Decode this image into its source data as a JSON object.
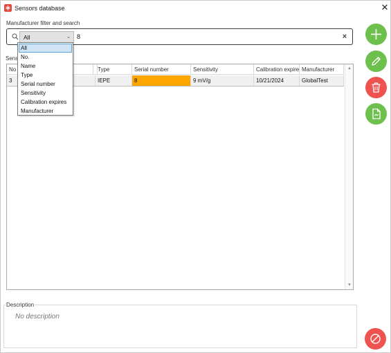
{
  "window": {
    "title": "Sensors database",
    "close_glyph": "✕"
  },
  "filter": {
    "group_label": "Manufacturer filter and search",
    "combo_value": "All",
    "search_value": "8",
    "clear_glyph": "×"
  },
  "sensors": {
    "group_label": "Sensors",
    "visible_label": "Senso",
    "columns": [
      "No.",
      "Name",
      "Type",
      "Serial number",
      "Sensitivity",
      "Calibration expires",
      "Manufacturer"
    ],
    "visible_columns": [
      "No",
      "",
      "Type",
      "Serial number",
      "Sensitivity",
      "Calibration expire",
      "Manufacturer"
    ],
    "rows": [
      {
        "no": "3",
        "name": "",
        "type": "IEPE",
        "serial_number": "8",
        "sensitivity": "9 mV/g",
        "calibration_expires": "10/21/2024",
        "manufacturer": "GlobalTest"
      }
    ],
    "highlight_color": "#ffa500"
  },
  "dropdown": {
    "options": [
      "All",
      "No.",
      "Name",
      "Type",
      "Serial number",
      "Sensitivity",
      "Calibration expires",
      "Manufacturer"
    ],
    "selected": "All"
  },
  "description": {
    "label": "Description",
    "text": "No description"
  },
  "actions": {
    "add": "plus-icon",
    "edit": "pencil-icon",
    "delete": "trash-icon",
    "document": "document-icon",
    "cancel": "cancel-icon"
  },
  "colors": {
    "green": "#6ec04d",
    "red": "#ef5350",
    "accent": "#5aa3d8"
  }
}
